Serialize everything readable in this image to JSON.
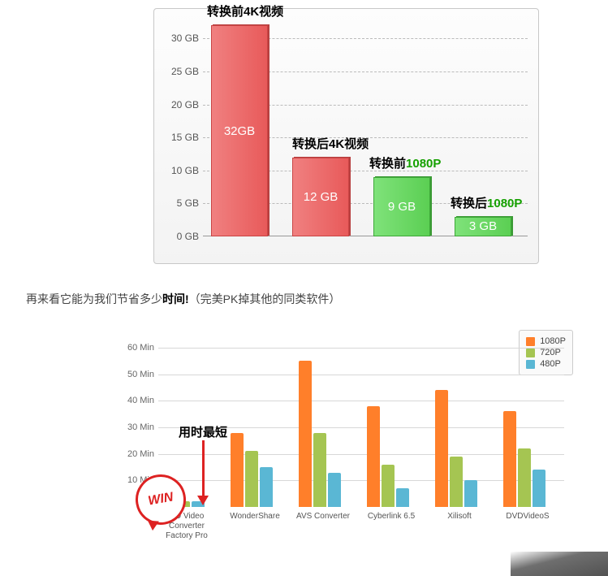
{
  "chart_data": [
    {
      "type": "bar",
      "title": "",
      "ylabel": "",
      "ylim": [
        0,
        32
      ],
      "y_ticks": [
        "0 GB",
        "5 GB",
        "10 GB",
        "15 GB",
        "20 GB",
        "25 GB",
        "30 GB"
      ],
      "categories": [
        "转换前4K视频",
        "转换后4K视频",
        "转换前1080P",
        "转换后1080P"
      ],
      "values": [
        32,
        12,
        9,
        3
      ],
      "value_labels": [
        "32GB",
        "12 GB",
        "9 GB",
        "3 GB"
      ],
      "colors": [
        "red",
        "red",
        "green",
        "green"
      ],
      "annotations": [
        {
          "text_black": "转换前4K视频",
          "text_green": "",
          "near": 0
        },
        {
          "text_black": "转换后4K视频",
          "text_green": "",
          "near": 1
        },
        {
          "text_black": "转换前",
          "text_green": "1080P",
          "near": 2
        },
        {
          "text_black": "转换后",
          "text_green": "1080P",
          "near": 3
        }
      ]
    },
    {
      "type": "bar",
      "title": "",
      "ylabel": "",
      "ylim": [
        0,
        60
      ],
      "y_ticks": [
        "10 Min",
        "20 Min",
        "30 Min",
        "40 Min",
        "50 Min",
        "60 Min"
      ],
      "categories": [
        "HD Video Converter Factory Pro",
        "WonderShare",
        "AVS Converter",
        "Cyberlink 6.5",
        "Xilisoft",
        "DVDVideoS"
      ],
      "series": [
        {
          "name": "1080P",
          "color": "#ff7f2a",
          "values": [
            3,
            28,
            55,
            38,
            44,
            36
          ]
        },
        {
          "name": "720P",
          "color": "#a5c552",
          "values": [
            2,
            21,
            28,
            16,
            19,
            22
          ]
        },
        {
          "name": "480P",
          "color": "#5ab7d4",
          "values": [
            2,
            15,
            13,
            7,
            10,
            14
          ]
        }
      ],
      "legend_position": "top-right",
      "annotations": [
        {
          "text": "用时最短",
          "target_category": 0
        },
        {
          "badge": "WIN",
          "target_category": 0
        }
      ]
    }
  ],
  "caption": {
    "prefix": "再来看它能为我们节省多少",
    "bold": "时间!",
    "suffix": "（完美PK掉其他的同类软件）"
  },
  "c1": {
    "yticks": [
      {
        "label": "0 GB",
        "v": 0
      },
      {
        "label": "5 GB",
        "v": 5
      },
      {
        "label": "10 GB",
        "v": 10
      },
      {
        "label": "15 GB",
        "v": 15
      },
      {
        "label": "20 GB",
        "v": 20
      },
      {
        "label": "25 GB",
        "v": 25
      },
      {
        "label": "30 GB",
        "v": 30
      }
    ],
    "bars": [
      {
        "label": "32GB",
        "v": 32,
        "color": "red"
      },
      {
        "label": "12 GB",
        "v": 12,
        "color": "red"
      },
      {
        "label": "9 GB",
        "v": 9,
        "color": "green"
      },
      {
        "label": "3 GB",
        "v": 3,
        "color": "green"
      }
    ],
    "ann": [
      {
        "black": "转换前4K视频",
        "green": ""
      },
      {
        "black": "转换后4K视频",
        "green": ""
      },
      {
        "black": "转换前",
        "green": "1080P"
      },
      {
        "black": "转换后",
        "green": "1080P"
      }
    ]
  },
  "c2": {
    "yticks": [
      {
        "label": "10 Min",
        "v": 10
      },
      {
        "label": "20 Min",
        "v": 20
      },
      {
        "label": "30 Min",
        "v": 30
      },
      {
        "label": "40 Min",
        "v": 40
      },
      {
        "label": "50 Min",
        "v": 50
      },
      {
        "label": "60 Min",
        "v": 60
      }
    ],
    "legend": {
      "o": "1080P",
      "g": "720P",
      "b": "480P"
    },
    "ann_shortest": "用时最短",
    "win": "WIN",
    "groups": [
      {
        "label": "HD Video Converter Factory Pro",
        "o": 3,
        "g": 2,
        "b": 2
      },
      {
        "label": "WonderShare",
        "o": 28,
        "g": 21,
        "b": 15
      },
      {
        "label": "AVS Converter",
        "o": 55,
        "g": 28,
        "b": 13
      },
      {
        "label": "Cyberlink 6.5",
        "o": 38,
        "g": 16,
        "b": 7
      },
      {
        "label": "Xilisoft",
        "o": 44,
        "g": 19,
        "b": 10
      },
      {
        "label": "DVDVideoS",
        "o": 36,
        "g": 22,
        "b": 14
      }
    ]
  }
}
